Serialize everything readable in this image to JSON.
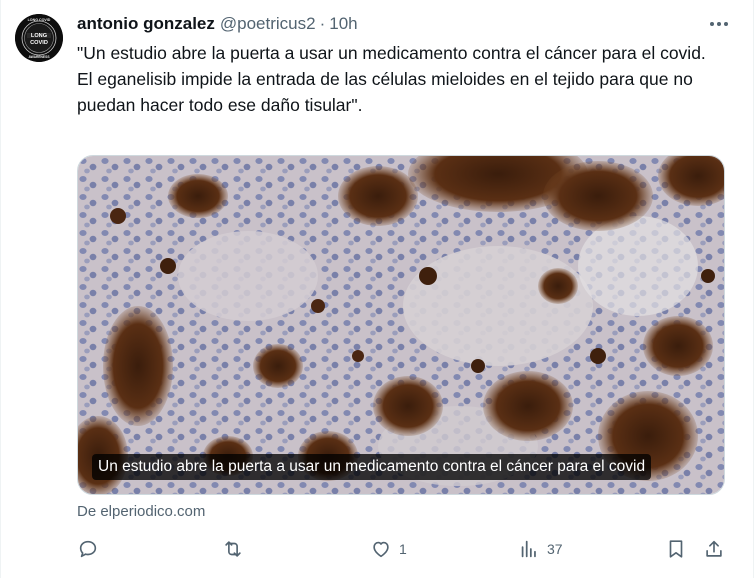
{
  "author": {
    "display_name": "antonio gonzalez",
    "handle": "@poetricus2",
    "separator": "·",
    "time": "10h",
    "avatar_text_top": "LONG",
    "avatar_text_bottom": "COVID",
    "avatar_ring_top": "LONG COVID",
    "avatar_ring_bottom": "AWARENESS"
  },
  "tweet": {
    "paragraph1": "\"Un estudio abre la puerta a usar un medicamento contra el cáncer para el covid.",
    "paragraph2": "El eganelisib impide la entrada de las células mieloides en el tejido para que no puedan hacer todo ese daño tisular\"."
  },
  "media": {
    "caption": "Un estudio abre la puerta a usar un medicamento contra el cáncer para el covid"
  },
  "source": {
    "label": "De elperiodico.com"
  },
  "actions": {
    "reply_count": "",
    "retweet_count": "",
    "like_count": "1",
    "views_count": "37"
  },
  "icons": {
    "more": "more-horizontal-icon",
    "reply": "reply-icon",
    "retweet": "retweet-icon",
    "like": "heart-icon",
    "views": "views-icon",
    "bookmark": "bookmark-icon",
    "share": "share-icon"
  },
  "colors": {
    "text_primary": "#0f1419",
    "text_secondary": "#536471",
    "border": "#cfd9de"
  }
}
